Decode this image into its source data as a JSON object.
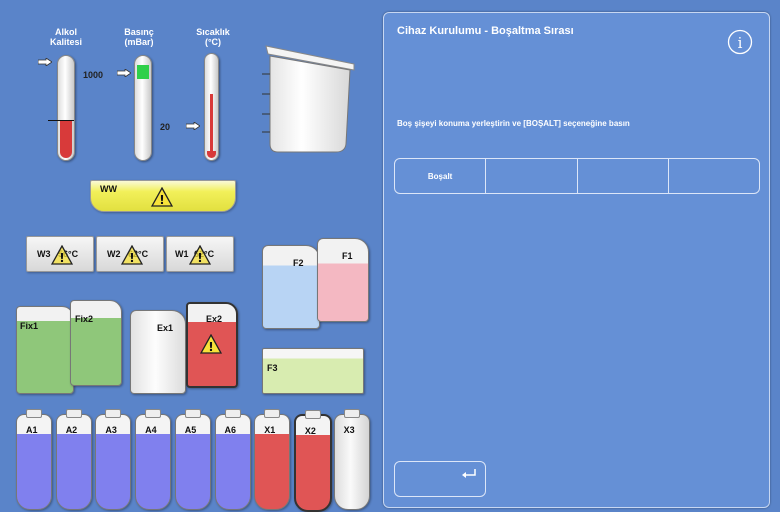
{
  "gauges": {
    "alcohol": {
      "label_line1": "Alkol",
      "label_line2": "Kalitesi"
    },
    "pressure": {
      "label_line1": "Basınç",
      "label_line2": "(mBar)",
      "value": "1000"
    },
    "temperature": {
      "label_line1": "Sıcaklık",
      "label_line2": "(°C)",
      "value": "20"
    }
  },
  "waste_tray": {
    "label": "WW"
  },
  "wax_baths": [
    {
      "label": "W3",
      "temp": "56°C"
    },
    {
      "label": "W2",
      "temp": "62°C"
    },
    {
      "label": "W1",
      "temp": "62°C"
    }
  ],
  "flush_bottles": {
    "f1": "F1",
    "f2": "F2",
    "f3": "F3"
  },
  "fixative": {
    "fix1": "Fix1",
    "fix2": "Fix2"
  },
  "extra": {
    "ex1": "Ex1",
    "ex2": "Ex2"
  },
  "reagent_bottles": [
    "A1",
    "A2",
    "A3",
    "A4",
    "A5",
    "A6",
    "X1",
    "X2",
    "X3"
  ],
  "panel": {
    "title": "Cihaz Kurulumu - Boşaltma Sırası",
    "instruction": "Boş şişeyi konuma yerleştirin ve [BOŞALT] seçeneğine basın",
    "buttons": [
      "Boşalt",
      "",
      "",
      ""
    ],
    "back_icon": "return-arrow-icon",
    "info_icon": "info-icon"
  },
  "colors": {
    "background": "#5a84c9",
    "panel": "#6590d6",
    "red": "#e05555",
    "green": "#8fc77a",
    "purple": "#8080ee",
    "yellow": "#f2f05a",
    "pink": "#f4b8c2",
    "light_blue": "#b8d4f4",
    "light_green": "#d8ecb0"
  }
}
